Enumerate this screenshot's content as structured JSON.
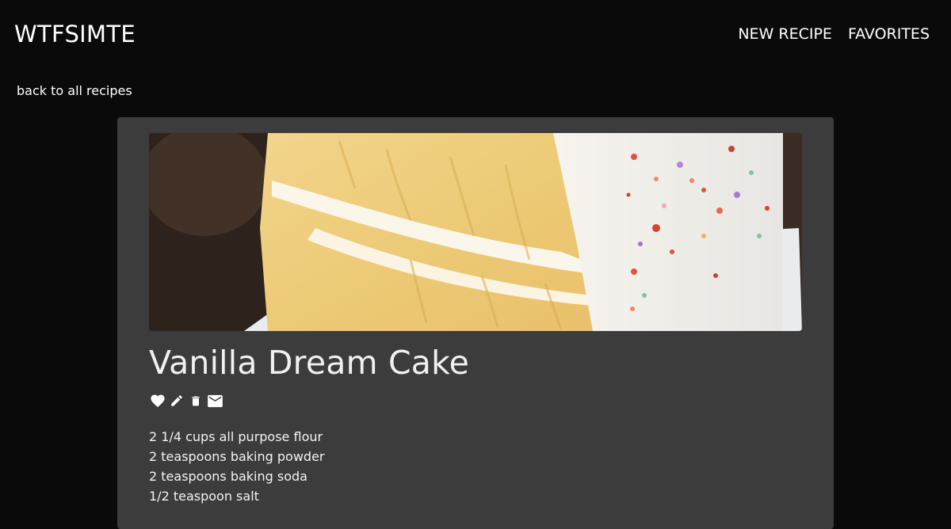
{
  "header": {
    "brand": "WTFSIMTE",
    "nav": [
      {
        "label": "NEW RECIPE"
      },
      {
        "label": "FAVORITES"
      }
    ]
  },
  "back_link": "back to all recipes",
  "recipe": {
    "title": "Vanilla Dream Cake",
    "image_icon": "cake-photo",
    "actions": [
      {
        "icon": "heart-icon"
      },
      {
        "icon": "pencil-icon"
      },
      {
        "icon": "trash-icon"
      },
      {
        "icon": "mail-icon"
      }
    ],
    "ingredients": [
      "2 1/4 cups all purpose flour",
      "2 teaspoons baking powder",
      "2 teaspoons baking soda",
      "1/2 teaspoon salt"
    ]
  },
  "colors": {
    "background": "#0b0a0b",
    "card": "#3c3c3c",
    "text": "#ffffff"
  }
}
